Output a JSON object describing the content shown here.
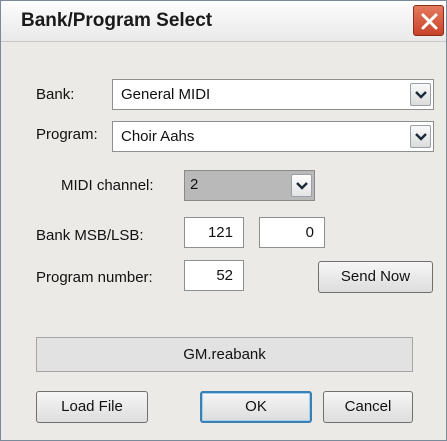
{
  "window": {
    "title": "Bank/Program Select"
  },
  "bank": {
    "label": "Bank:",
    "value": "General MIDI"
  },
  "program": {
    "label": "Program:",
    "value": "Choir Aahs"
  },
  "midi_channel": {
    "label": "MIDI channel:",
    "value": "2"
  },
  "bank_msb_lsb": {
    "label": "Bank MSB/LSB:",
    "msb": "121",
    "lsb": "0"
  },
  "program_number": {
    "label": "Program number:",
    "value": "52"
  },
  "buttons": {
    "send_now": "Send Now",
    "load_file": "Load File",
    "ok": "OK",
    "cancel": "Cancel"
  },
  "status": {
    "file": "GM.reabank"
  },
  "icons": {
    "close": "close-icon",
    "dropdown": "chevron-down-icon"
  }
}
